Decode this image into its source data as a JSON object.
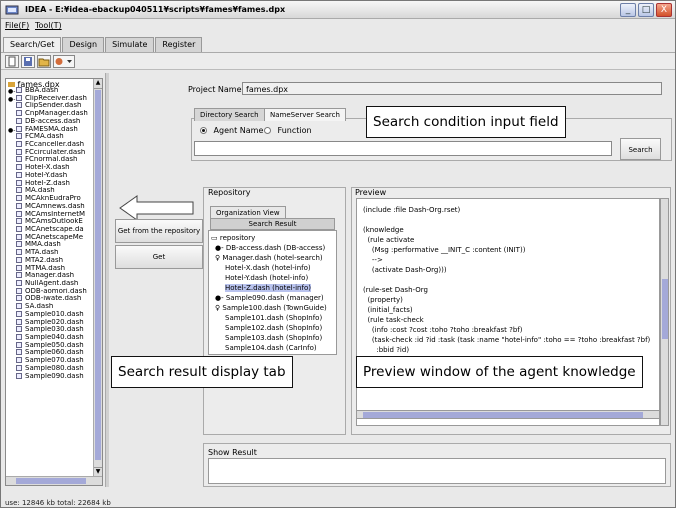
{
  "window": {
    "title": "IDEA - E:¥idea-ebackup040511¥scripts¥fames¥fames.dpx",
    "buttons": {
      "minimize": "_",
      "maximize": "□",
      "close": "X"
    }
  },
  "menu": [
    "File(F)",
    "Tool(T)"
  ],
  "top_tabs": [
    "Search/Get",
    "Design",
    "Simulate",
    "Register"
  ],
  "toolbar_icons": [
    "new-file-icon",
    "save-icon",
    "open-folder-icon",
    "settings-dropdown-icon"
  ],
  "file_tree": {
    "root": "fames.dpx",
    "items": [
      "BBA.dash",
      "ClipReceiver.dash",
      "ClipSender.dash",
      "CnpManager.dash",
      "DB-access.dash",
      "FAMESMA.dash",
      "FCMA.dash",
      "FCcanceller.dash",
      "FCcirculater.dash",
      "FCnormal.dash",
      "Hotel-X.dash",
      "Hotel-Y.dash",
      "Hotel-Z.dash",
      "MA.dash",
      "MCAknEudraPro",
      "MCAmnews.dash",
      "MCAmsInternetM",
      "MCAmsOutlookE",
      "MCAnetscape.da",
      "MCAnetscapeMe",
      "MMA.dash",
      "MTA.dash",
      "MTA2.dash",
      "MTMA.dash",
      "Manager.dash",
      "NullAgent.dash",
      "ODB-aomori.dash",
      "ODB-iwate.dash",
      "SA.dash",
      "Sample010.dash",
      "Sample020.dash",
      "Sample030.dash",
      "Sample040.dash",
      "Sample050.dash",
      "Sample060.dash",
      "Sample070.dash",
      "Sample080.dash",
      "Sample090.dash"
    ]
  },
  "status_bar": "use: 12846 kb   total: 22684 kb",
  "project": {
    "label": "Project Name :",
    "value": "fames.dpx"
  },
  "search_tabs": [
    "Directory Search",
    "NameServer Search"
  ],
  "search_radios": [
    {
      "label": "Agent Name",
      "selected": true
    },
    {
      "label": "Function",
      "selected": false
    }
  ],
  "search_button": "Search",
  "get_repo_button": "Get from the repository",
  "get_button": "Get",
  "repository": {
    "title": "Repository",
    "tabs": [
      "Organization View",
      "Search Result"
    ],
    "nodes": [
      "repository",
      "DB-access.dash (DB-access)",
      "Manager.dash (hotel-search)",
      "Hotel-X.dash (hotel-info)",
      "Hotel-Y.dash (hotel-info)",
      "Hotel-Z.dash (hotel-info)",
      "Sample090.dash (manager)",
      "Sample100.dash (TownGuide)",
      "Sample101.dash (ShopInfo)",
      "Sample102.dash (ShopInfo)",
      "Sample103.dash (ShopInfo)",
      "Sample104.dash (CarInfo)"
    ]
  },
  "preview": {
    "title": "Preview",
    "lines": [
      "(include :file Dash-Org.rset)",
      "",
      "(knowledge",
      "  (rule activate",
      "    (Msg :performative __INIT_C :content (INIT))",
      "    -->",
      "    (activate Dash-Org)))",
      "",
      "(rule-set Dash-Org",
      "  (property)",
      "  (initial_facts)",
      "  (rule task-check",
      "    (info :cost ?cost :toho ?toho :breakfast ?bf)",
      "    (task-check :id ?id :task (task :name \"hotel-info\" :toho == ?toho :breakfast ?bf)",
      "      :bbid ?id)"
    ]
  },
  "show_result": {
    "title": "Show Result"
  },
  "callouts": {
    "search_input": "Search condition input field",
    "result_tab": "Search result display tab",
    "preview_window": "Preview window of the agent knowledge"
  },
  "colors": {
    "selection": "#b9c3ee",
    "scrollbar_thumb": "#a4a9d8",
    "tree_icon": "#d9a43a"
  }
}
